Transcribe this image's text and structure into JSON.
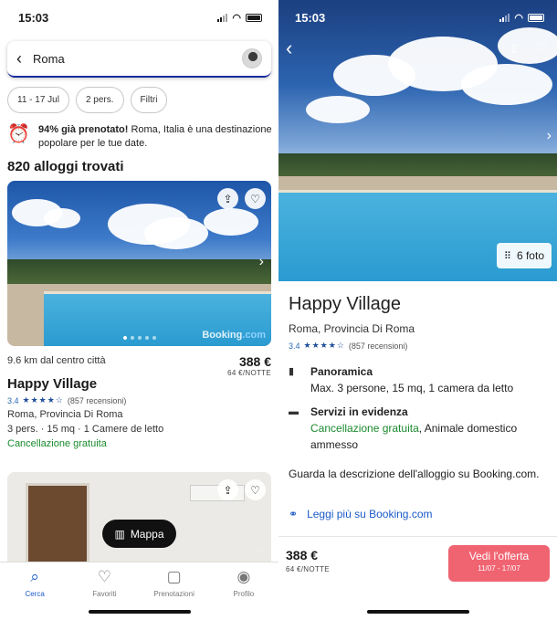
{
  "status": {
    "time": "15:03"
  },
  "search": {
    "query": "Roma"
  },
  "chips": [
    "11 - 17 Jul",
    "2 pers.",
    "Filtri"
  ],
  "promo": {
    "bold": "94% già prenotato!",
    "text": " Roma, Italia è una destinazione popolare per le tue date."
  },
  "results_count": "820 alloggi trovati",
  "listing": {
    "distance": "9.6 km dal centro città",
    "price": "388 €",
    "per_night": "64 €/NOTTE",
    "name": "Happy Village",
    "rating": "3.4",
    "stars": "★★★★☆",
    "reviews": "(857 recensioni)",
    "location": "Roma, Provincia Di Roma",
    "details": "3 pers.  ·  15 mq  ·  1 Camere de letto",
    "cancellation": "Cancellazione gratuita",
    "watermark_a": "Booking",
    "watermark_b": ".com"
  },
  "map_button": "Mappa",
  "tabs": [
    {
      "label": "Cerca",
      "icon": "search-icon"
    },
    {
      "label": "Favoriti",
      "icon": "heart-icon"
    },
    {
      "label": "Prenotazioni",
      "icon": "bag-icon"
    },
    {
      "label": "Profilo",
      "icon": "profile-icon"
    }
  ],
  "detail": {
    "photos": "6 foto",
    "name": "Happy Village",
    "location": "Roma, Provincia Di Roma",
    "rating": "3.4",
    "stars": "★★★★☆",
    "reviews": "(857 recensioni)",
    "overview_title": "Panoramica",
    "overview_text": "Max. 3 persone, 15 mq, 1 camera da letto",
    "services_title": "Servizi in evidenza",
    "services_green": "Cancellazione gratuita",
    "services_rest": ", Animale domestico ammesso",
    "description": "Guarda la descrizione dell'alloggio su Booking.com.",
    "link": "Leggi più su Booking.com",
    "price": "388 €",
    "per_night": "64 €/NOTTE",
    "cta": "Vedi l'offerta",
    "cta_dates": "11/07 - 17/07"
  },
  "colors": {
    "accent": "#1a5ac8",
    "cta": "#f06472",
    "green": "#1a8a2e",
    "brand_underline": "#1a2c9e"
  }
}
